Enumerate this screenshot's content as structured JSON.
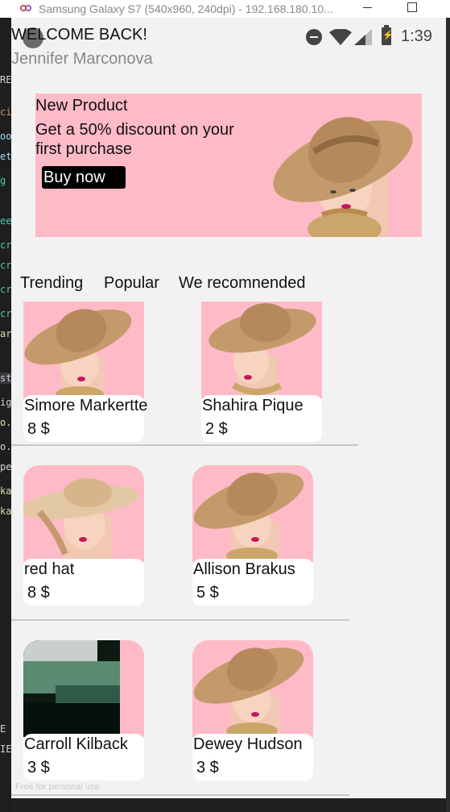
{
  "window": {
    "title": "Samsung Galaxy S7 (540x960, 240dpi) - 192.168.180.10..."
  },
  "status_bar": {
    "time": "1:39"
  },
  "header": {
    "greeting": "WELCOME BACK!",
    "user_name": "Jennifer Marconova"
  },
  "banner": {
    "kicker": "New Product",
    "headline": "Get a 50% discount on your first purchase",
    "button_label": "Buy now",
    "background_color": "#ffbac7"
  },
  "tabs": [
    {
      "label": "Trending"
    },
    {
      "label": "Popular"
    },
    {
      "label": "We recomnended"
    }
  ],
  "products": [
    {
      "name": "Simore Markertte",
      "price": "8 $"
    },
    {
      "name": "Shahira Pique",
      "price": "2 $"
    },
    {
      "name": "red hat",
      "price": "8 $"
    },
    {
      "name": "Allison Brakus",
      "price": "5 $"
    },
    {
      "name": "Carroll Kilback",
      "price": "3 $"
    },
    {
      "name": "Dewey Hudson",
      "price": "3 $"
    }
  ],
  "footer": {
    "watermark": "Free for personal use"
  },
  "colors": {
    "card_image_bg": "#ffbac7",
    "button_bg": "#000000",
    "divider": "#c8c8c8"
  }
}
